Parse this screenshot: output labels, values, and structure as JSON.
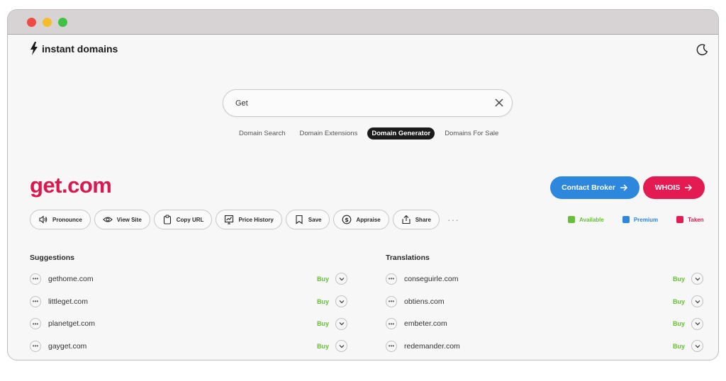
{
  "window": {
    "controls": [
      "close",
      "minimize",
      "maximize"
    ]
  },
  "header": {
    "logo_text": "instant domains",
    "logo_icon": "bolt-icon",
    "theme_icon": "moon-icon"
  },
  "search": {
    "value": "Get",
    "placeholder": ""
  },
  "tabs": [
    {
      "label": "Domain Search",
      "active": false
    },
    {
      "label": "Domain Extensions",
      "active": false
    },
    {
      "label": "Domain Generator",
      "active": true
    },
    {
      "label": "Domains For Sale",
      "active": false
    }
  ],
  "result": {
    "domain": "get.com",
    "contact_broker_label": "Contact Broker",
    "whois_label": "WHOIS"
  },
  "actions": [
    {
      "label": "Pronounce",
      "icon": "speaker-icon"
    },
    {
      "label": "View Site",
      "icon": "eye-icon"
    },
    {
      "label": "Copy URL",
      "icon": "clipboard-icon"
    },
    {
      "label": "Price History",
      "icon": "chart-icon"
    },
    {
      "label": "Save",
      "icon": "bookmark-icon"
    },
    {
      "label": "Appraise",
      "icon": "dollar-icon"
    },
    {
      "label": "Share",
      "icon": "share-icon"
    }
  ],
  "more_label": "···",
  "legend": [
    {
      "label": "Available",
      "color": "#6abf3a"
    },
    {
      "label": "Premium",
      "color": "#2d87dc"
    },
    {
      "label": "Taken",
      "color": "#e41a52"
    }
  ],
  "suggestions": {
    "title": "Suggestions",
    "items": [
      {
        "name": "gethome.com",
        "action": "Buy"
      },
      {
        "name": "littleget.com",
        "action": "Buy"
      },
      {
        "name": "planetget.com",
        "action": "Buy"
      },
      {
        "name": "gayget.com",
        "action": "Buy"
      }
    ]
  },
  "translations": {
    "title": "Translations",
    "items": [
      {
        "name": "conseguirle.com",
        "action": "Buy"
      },
      {
        "name": "obtiens.com",
        "action": "Buy"
      },
      {
        "name": "embeter.com",
        "action": "Buy"
      },
      {
        "name": "redemander.com",
        "action": "Buy"
      }
    ]
  },
  "colors": {
    "brand_red": "#d8184f",
    "broker_blue": "#2d87dc",
    "whois_red": "#e41a52",
    "available_green": "#6abf3a"
  }
}
